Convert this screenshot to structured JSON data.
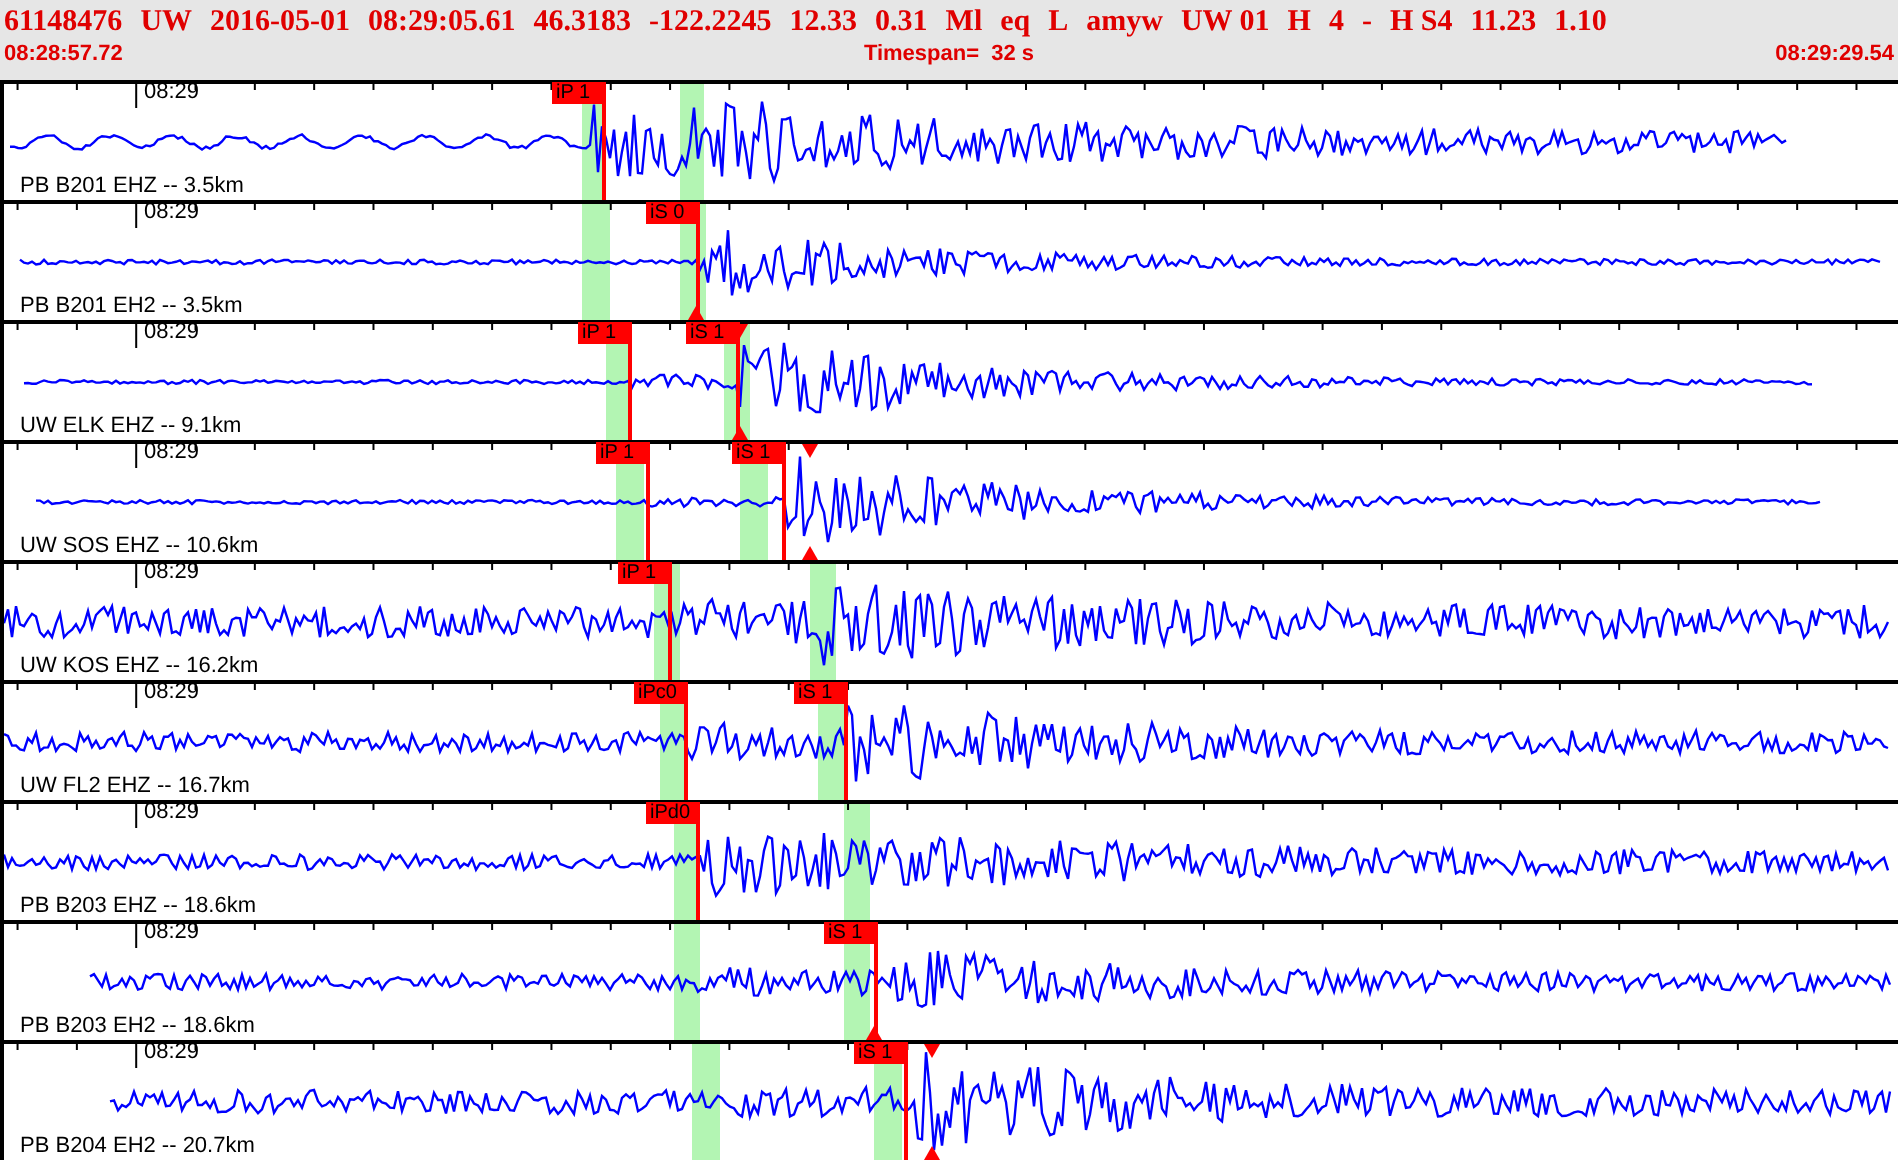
{
  "header": {
    "fields": [
      "61148476",
      "UW",
      "2016-05-01",
      "08:29:05.61",
      "46.3183",
      "-122.2245",
      "12.33",
      "0.31",
      "Ml",
      "eq",
      "L",
      "amyw",
      "UW 01",
      "H",
      "4",
      "-",
      "H S4",
      "11.23",
      "1.10"
    ]
  },
  "time_bar": {
    "start": "08:28:57.72",
    "timespan": "Timespan=  32 s",
    "end": "08:29:29.54"
  },
  "traces": [
    {
      "station": "PB B201 EHZ -- 3.5km",
      "time_label": "08:29",
      "picks": [
        {
          "label": "iP 1"
        }
      ]
    },
    {
      "station": "PB B201 EH2 -- 3.5km",
      "time_label": "08:29",
      "picks": [
        {
          "label": "iS 0"
        }
      ]
    },
    {
      "station": "UW ELK EHZ -- 9.1km",
      "time_label": "08:29",
      "picks": [
        {
          "label": "iP 1"
        },
        {
          "label": "iS 1"
        }
      ]
    },
    {
      "station": "UW SOS EHZ -- 10.6km",
      "time_label": "08:29",
      "picks": [
        {
          "label": "iP 1"
        },
        {
          "label": "iS 1"
        }
      ]
    },
    {
      "station": "UW KOS EHZ -- 16.2km",
      "time_label": "08:29",
      "picks": [
        {
          "label": "iP 1"
        }
      ]
    },
    {
      "station": "UW FL2 EHZ -- 16.7km",
      "time_label": "08:29",
      "picks": [
        {
          "label": "iPc0"
        },
        {
          "label": "iS 1"
        }
      ]
    },
    {
      "station": "PB B203 EHZ -- 18.6km",
      "time_label": "08:29",
      "picks": [
        {
          "label": "iPd0"
        }
      ]
    },
    {
      "station": "PB B203 EH2 -- 18.6km",
      "time_label": "08:29",
      "picks": [
        {
          "label": "iS 1"
        }
      ]
    },
    {
      "station": "PB B204 EH2 -- 20.7km",
      "time_label": "08:29",
      "picks": [
        {
          "label": "iS 1"
        }
      ]
    }
  ]
}
